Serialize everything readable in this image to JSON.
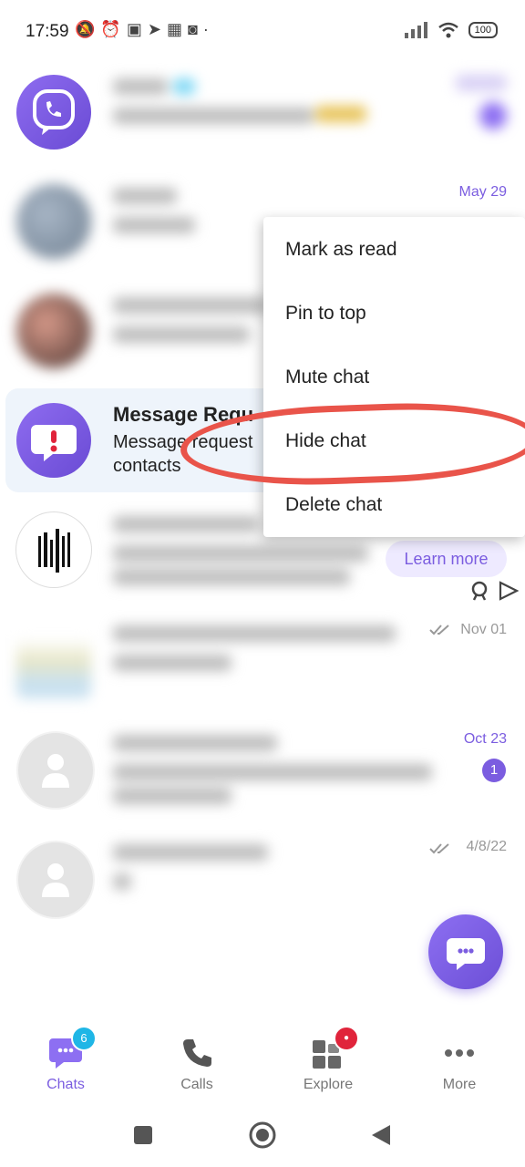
{
  "status": {
    "time": "17:59",
    "battery": "100"
  },
  "chats": [
    {
      "date": "May 29"
    },
    {
      "title": "Message Requ",
      "preview_line1": "Message request",
      "preview_line2": "contacts"
    },
    {
      "learn_more": "Learn more"
    },
    {
      "date": "Nov 01"
    },
    {
      "date": "Oct 23",
      "unread": "1"
    },
    {
      "date": "4/8/22"
    }
  ],
  "menu": {
    "items": [
      "Mark as read",
      "Pin to top",
      "Mute chat",
      "Hide chat",
      "Delete chat"
    ]
  },
  "nav": {
    "chats": {
      "label": "Chats",
      "badge": "6"
    },
    "calls": {
      "label": "Calls"
    },
    "explore": {
      "label": "Explore"
    },
    "more": {
      "label": "More"
    }
  },
  "colors": {
    "accent": "#7b5de0",
    "annotation": "#e9544a",
    "badge_blue": "#1fb6e6",
    "badge_red": "#e0243b"
  }
}
